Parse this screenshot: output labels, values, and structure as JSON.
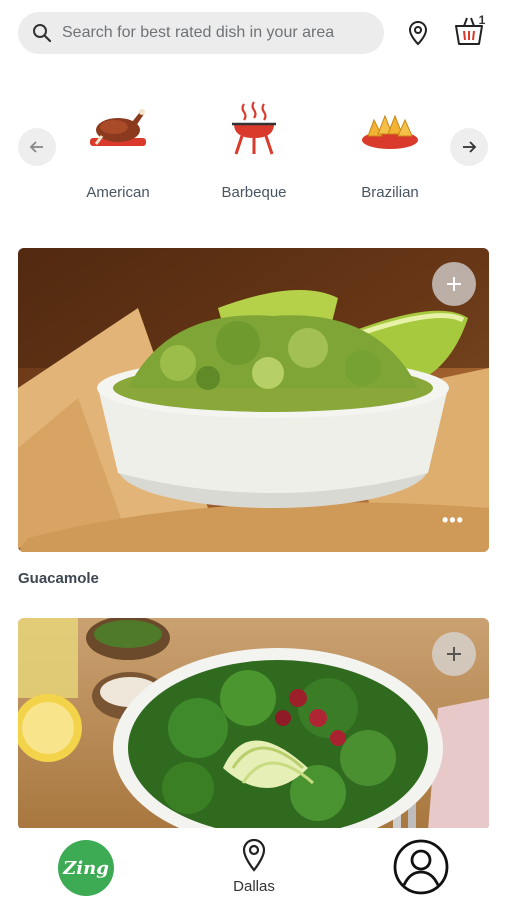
{
  "search": {
    "placeholder": "Search for best rated dish in your area",
    "value": ""
  },
  "header": {
    "location_icon": "location-pin-icon",
    "cart_icon": "shopping-basket-icon",
    "cart_count": "1"
  },
  "categories": {
    "prev_icon": "arrow-left-icon",
    "next_icon": "arrow-right-icon",
    "items": [
      {
        "label": "American",
        "icon": "roast-chicken-icon"
      },
      {
        "label": "Barbeque",
        "icon": "grill-icon"
      },
      {
        "label": "Brazilian",
        "icon": "pastries-plate-icon"
      }
    ]
  },
  "dishes": [
    {
      "name": "Guacamole",
      "add_icon": "plus-icon",
      "more_icon": "more-dots-icon"
    },
    {
      "name": "",
      "add_icon": "plus-icon"
    }
  ],
  "bottom_nav": {
    "logo_text": "Zing",
    "location_label": "Dallas",
    "profile_icon": "user-profile-icon"
  },
  "colors": {
    "brand_green": "#3dab54",
    "accent_red": "#d93a2b",
    "text_dark": "#3e4852"
  }
}
